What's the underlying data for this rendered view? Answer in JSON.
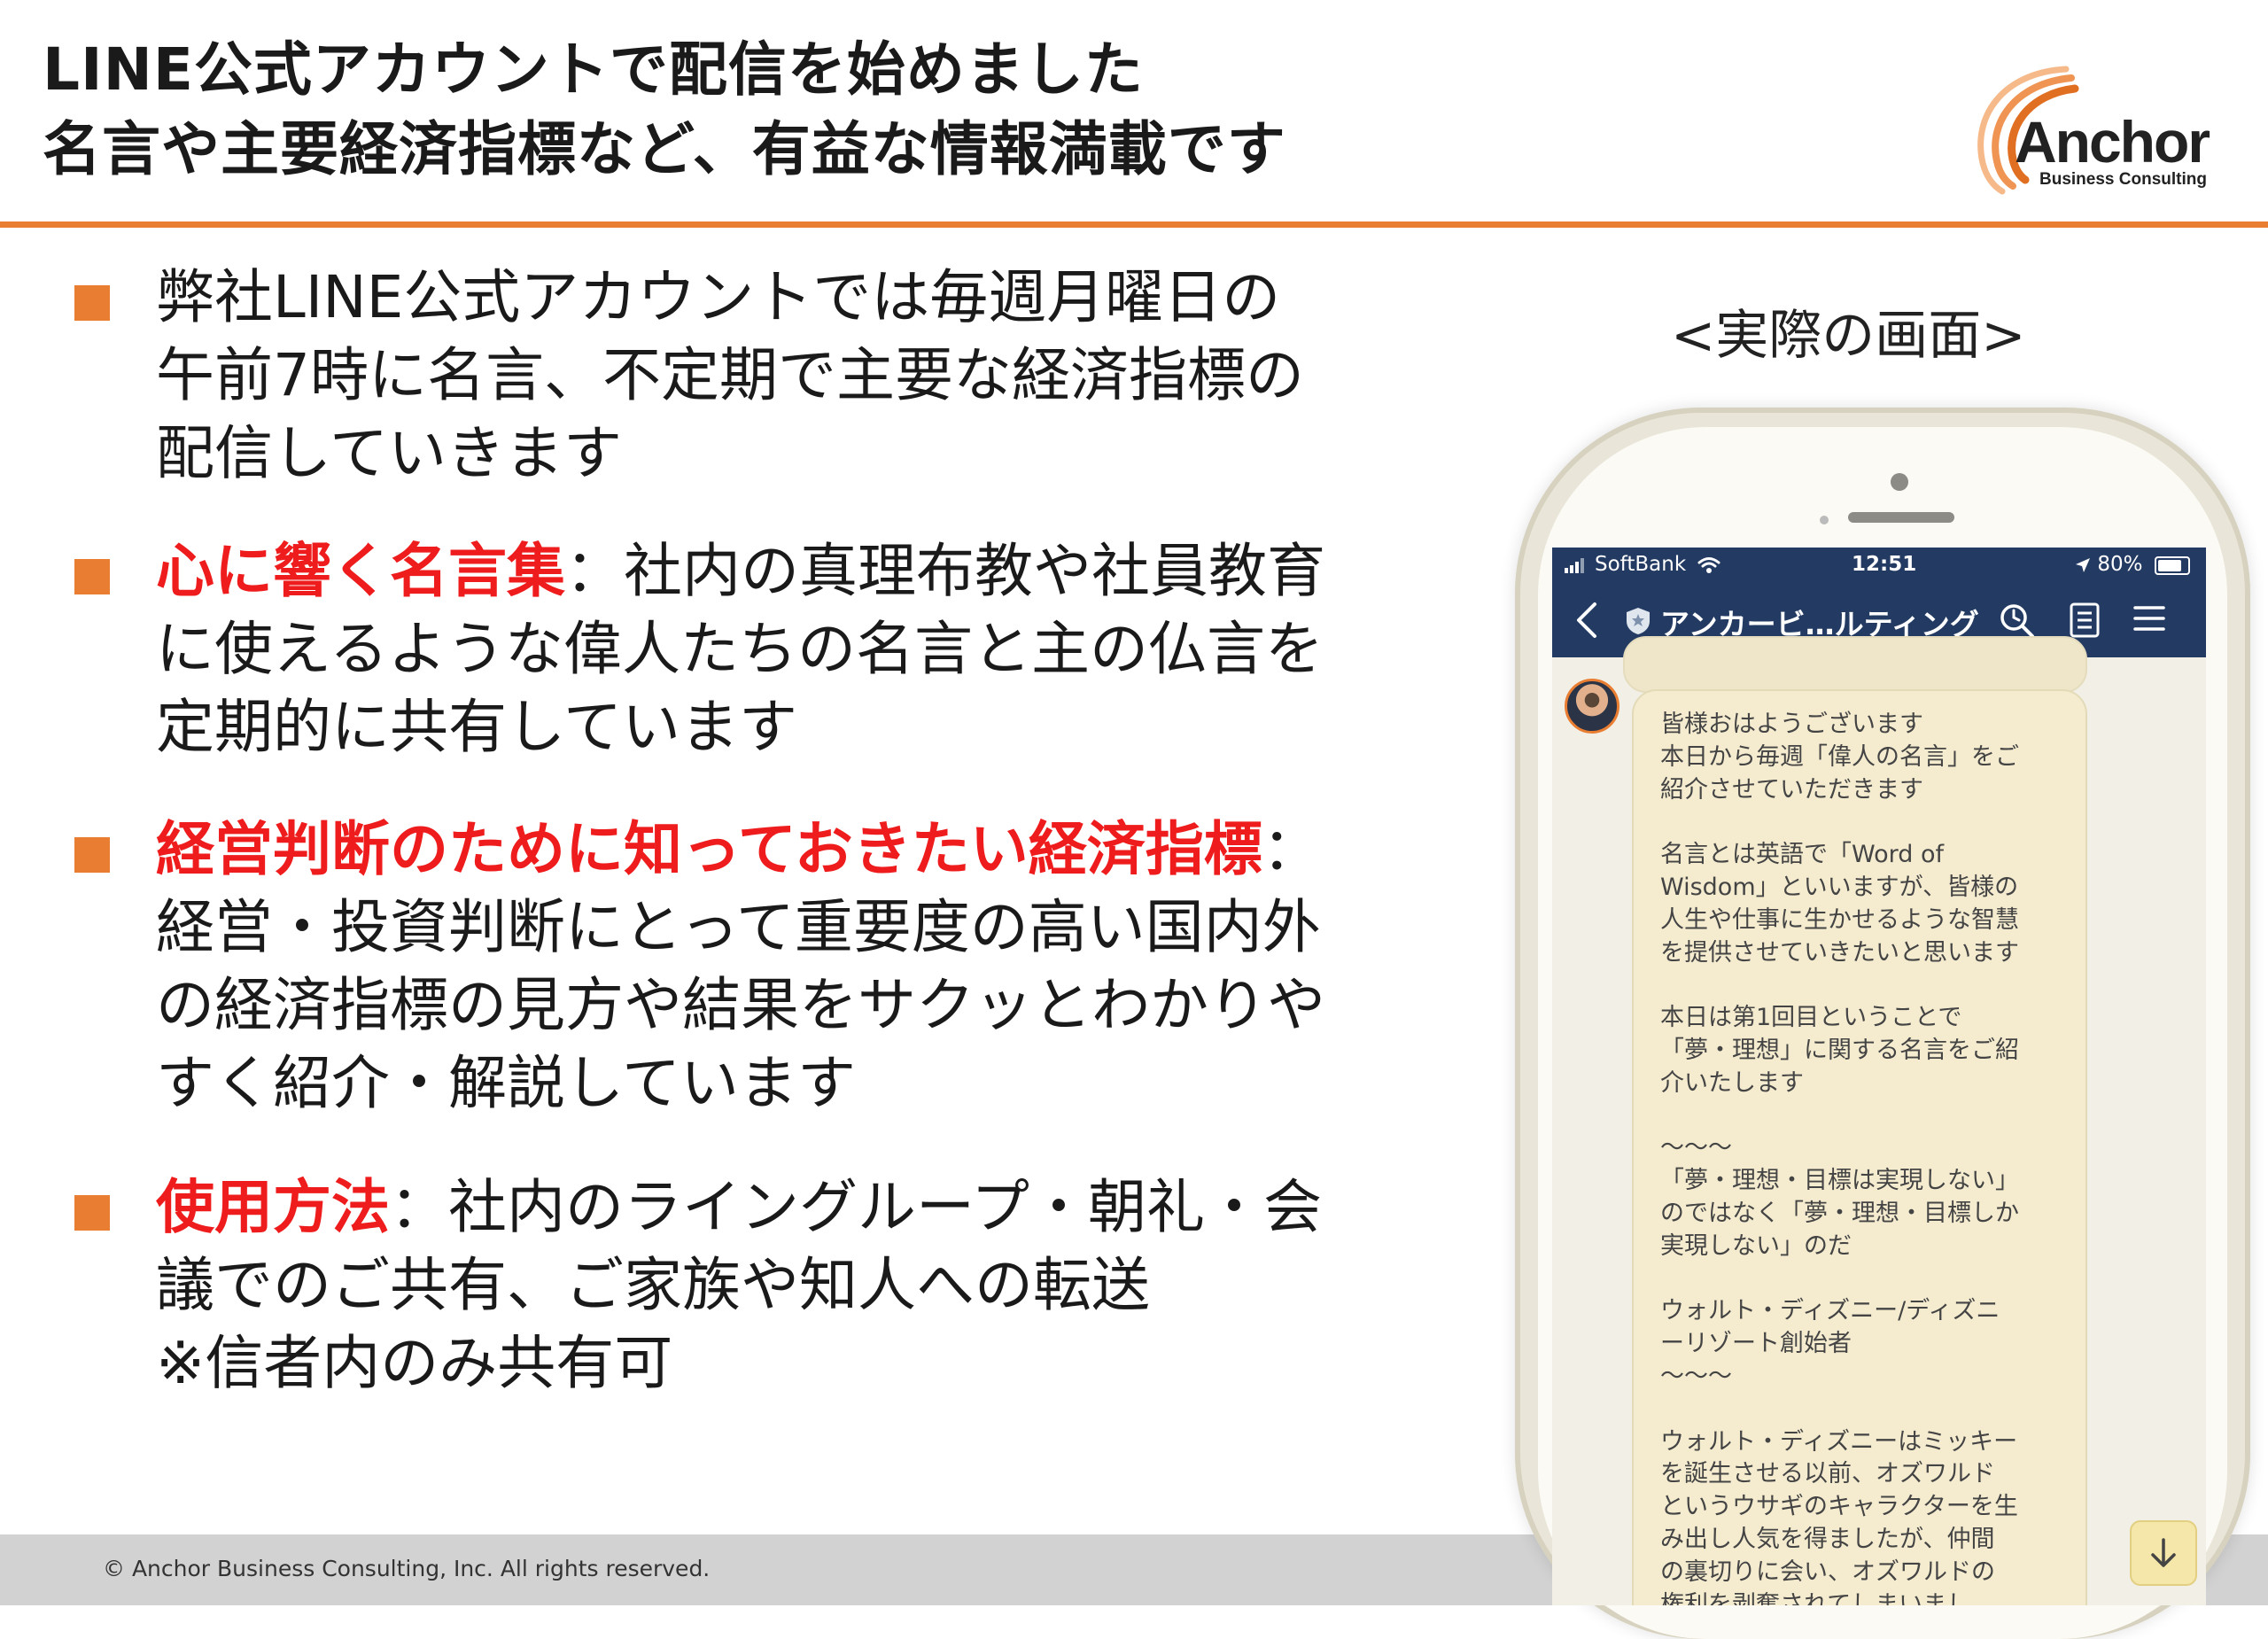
{
  "header": {
    "title_line1": "LINE公式アカウントで配信を始めました",
    "title_line2": "名言や主要経済指標など、有益な情報満載です"
  },
  "logo": {
    "name": "Anchor",
    "subtitle": "Business Consulting",
    "accent_color": "#e97e32"
  },
  "bullets": [
    {
      "lines": [
        "弊社LINE公式アカウントでは毎週月曜日の",
        "午前7時に名言、不定期で主要な経済指標の",
        "配信していきます"
      ]
    },
    {
      "highlight": "心に響く名言集",
      "line1_rest": "：社内の真理布教や社員教育",
      "lines": [
        "に使えるような偉人たちの名言と主の仏言を",
        "定期的に共有しています"
      ]
    },
    {
      "highlight": "経営判断のために知っておきたい経済指標",
      "line1_rest": "：",
      "lines": [
        "経営・投資判断にとって重要度の高い国内外",
        "の経済指標の見方や結果をサクッとわかりや",
        "すく紹介・解説しています"
      ]
    },
    {
      "highlight": "使用方法",
      "line1_rest": "：社内のライングループ・朝礼・会",
      "lines": [
        "議でのご共有、ご家族や知人への転送",
        "※信者内のみ共有可"
      ]
    }
  ],
  "caption": "<実際の画面>",
  "phone": {
    "status": {
      "carrier": "SoftBank",
      "time": "12:51",
      "battery": "80%"
    },
    "nav": {
      "title": "アンカービ…ルティング",
      "icons": [
        "back-chevron-icon",
        "shield-icon",
        "search-icon",
        "notes-icon",
        "menu-icon"
      ]
    },
    "message_lines": [
      "皆様おはようございます",
      "本日から毎週「偉人の名言」をご",
      "紹介させていただきます",
      "",
      "名言とは英語で「Word of",
      "Wisdom」といいますが、皆様の",
      "人生や仕事に生かせるような智慧",
      "を提供させていきたいと思います",
      "",
      "本日は第1回目ということで",
      "「夢・理想」に関する名言をご紹",
      "介いたします",
      "",
      "〜〜〜",
      "「夢・理想・目標は実現しない」",
      "のではなく「夢・理想・目標しか",
      "実現しない」のだ",
      "",
      "ウォルト・ディズニー/ディズニ",
      "ーリゾート創始者",
      "〜〜〜",
      "",
      "ウォルト・ディズニーはミッキー",
      "を誕生させる以前、オズワルド",
      "というウサギのキャラクターを生",
      "み出し人気を得ましたが、仲間",
      "の裏切りに会い、オズワルドの",
      "権利を剥奪されてしまいまし"
    ]
  },
  "footer": {
    "copyright": "© Anchor Business Consulting, Inc. All rights reserved."
  }
}
